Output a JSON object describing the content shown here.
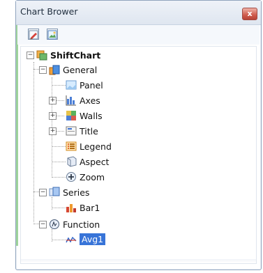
{
  "window": {
    "title": "Chart Brower",
    "close_label": "x"
  },
  "toolbar": {
    "buttons": [
      {
        "name": "edit-icon"
      },
      {
        "name": "image-icon"
      }
    ]
  },
  "tree": {
    "root": {
      "label": "ShiftChart",
      "expander": "−"
    },
    "general": {
      "label": "General",
      "expander": "−",
      "children": [
        {
          "label": "Panel"
        },
        {
          "label": "Axes",
          "expander": "+"
        },
        {
          "label": "Walls",
          "expander": "+"
        },
        {
          "label": "Title",
          "expander": "+"
        },
        {
          "label": "Legend"
        },
        {
          "label": "Aspect"
        },
        {
          "label": "Zoom"
        }
      ]
    },
    "series": {
      "label": "Series",
      "expander": "−",
      "children": [
        {
          "label": "Bar1"
        }
      ]
    },
    "function": {
      "label": "Function",
      "expander": "−",
      "children": [
        {
          "label": "Avg1",
          "selected": true
        }
      ]
    }
  }
}
